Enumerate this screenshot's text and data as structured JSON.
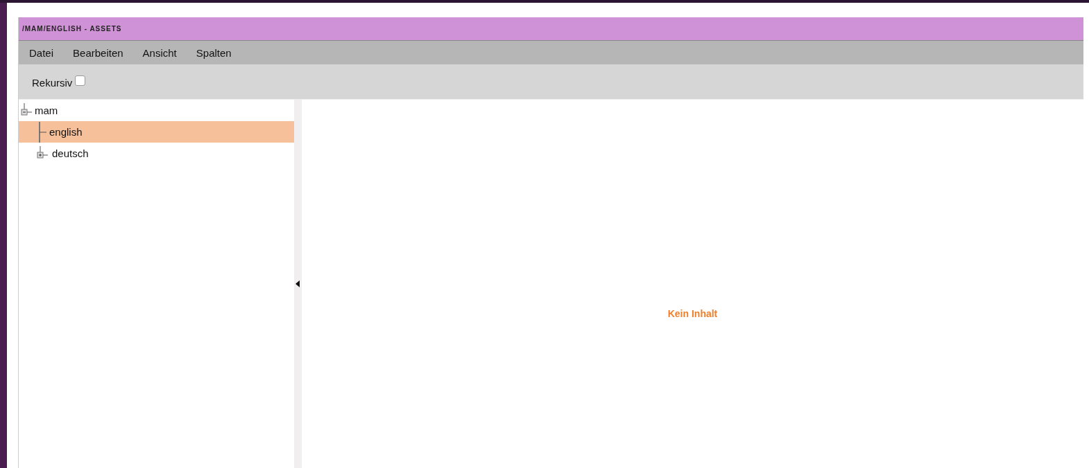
{
  "window": {
    "title": "/MAM/ENGLISH - ASSETS"
  },
  "menu": [
    {
      "label": "Datei"
    },
    {
      "label": "Bearbeiten"
    },
    {
      "label": "Ansicht"
    },
    {
      "label": "Spalten"
    }
  ],
  "toolbar": {
    "recursive": {
      "label": "Rekursiv",
      "checked": false
    }
  },
  "tree": [
    {
      "label": "mam",
      "expanded": true,
      "selected": false,
      "children": [
        {
          "label": "english",
          "selected": true
        },
        {
          "label": "deutsch",
          "selected": false,
          "expanded": false
        }
      ]
    }
  ],
  "content": {
    "empty_message": "Kein Inhalt"
  }
}
